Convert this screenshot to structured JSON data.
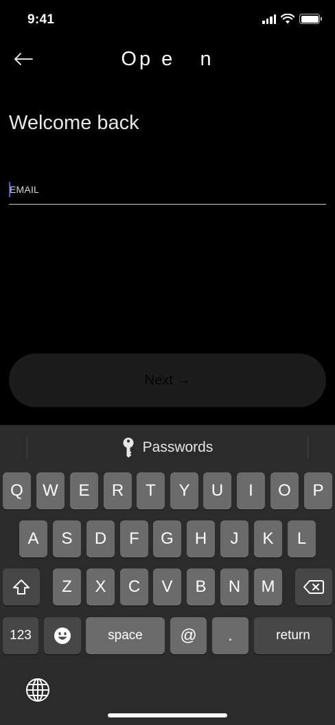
{
  "status_bar": {
    "time": "9:41"
  },
  "header": {
    "title": "Op e   n"
  },
  "content": {
    "welcome": "Welcome back",
    "email_placeholder": "EMAIL",
    "next_label": "Next →"
  },
  "keyboard": {
    "suggestion": "Passwords",
    "row1": [
      "Q",
      "W",
      "E",
      "R",
      "T",
      "Y",
      "U",
      "I",
      "O",
      "P"
    ],
    "row2": [
      "A",
      "S",
      "D",
      "F",
      "G",
      "H",
      "J",
      "K",
      "L"
    ],
    "row3": [
      "Z",
      "X",
      "C",
      "V",
      "B",
      "N",
      "M"
    ],
    "numbers_key": "123",
    "space_key": "space",
    "at_key": "@",
    "dot_key": ".",
    "return_key": "return"
  },
  "colors": {
    "background": "#000000",
    "keyboard_bg": "#2b2b2b",
    "key_bg": "#6b6b6b",
    "key_dark_bg": "#474747",
    "button_bg": "#1c1c1c",
    "caret": "#4a5bd6"
  }
}
